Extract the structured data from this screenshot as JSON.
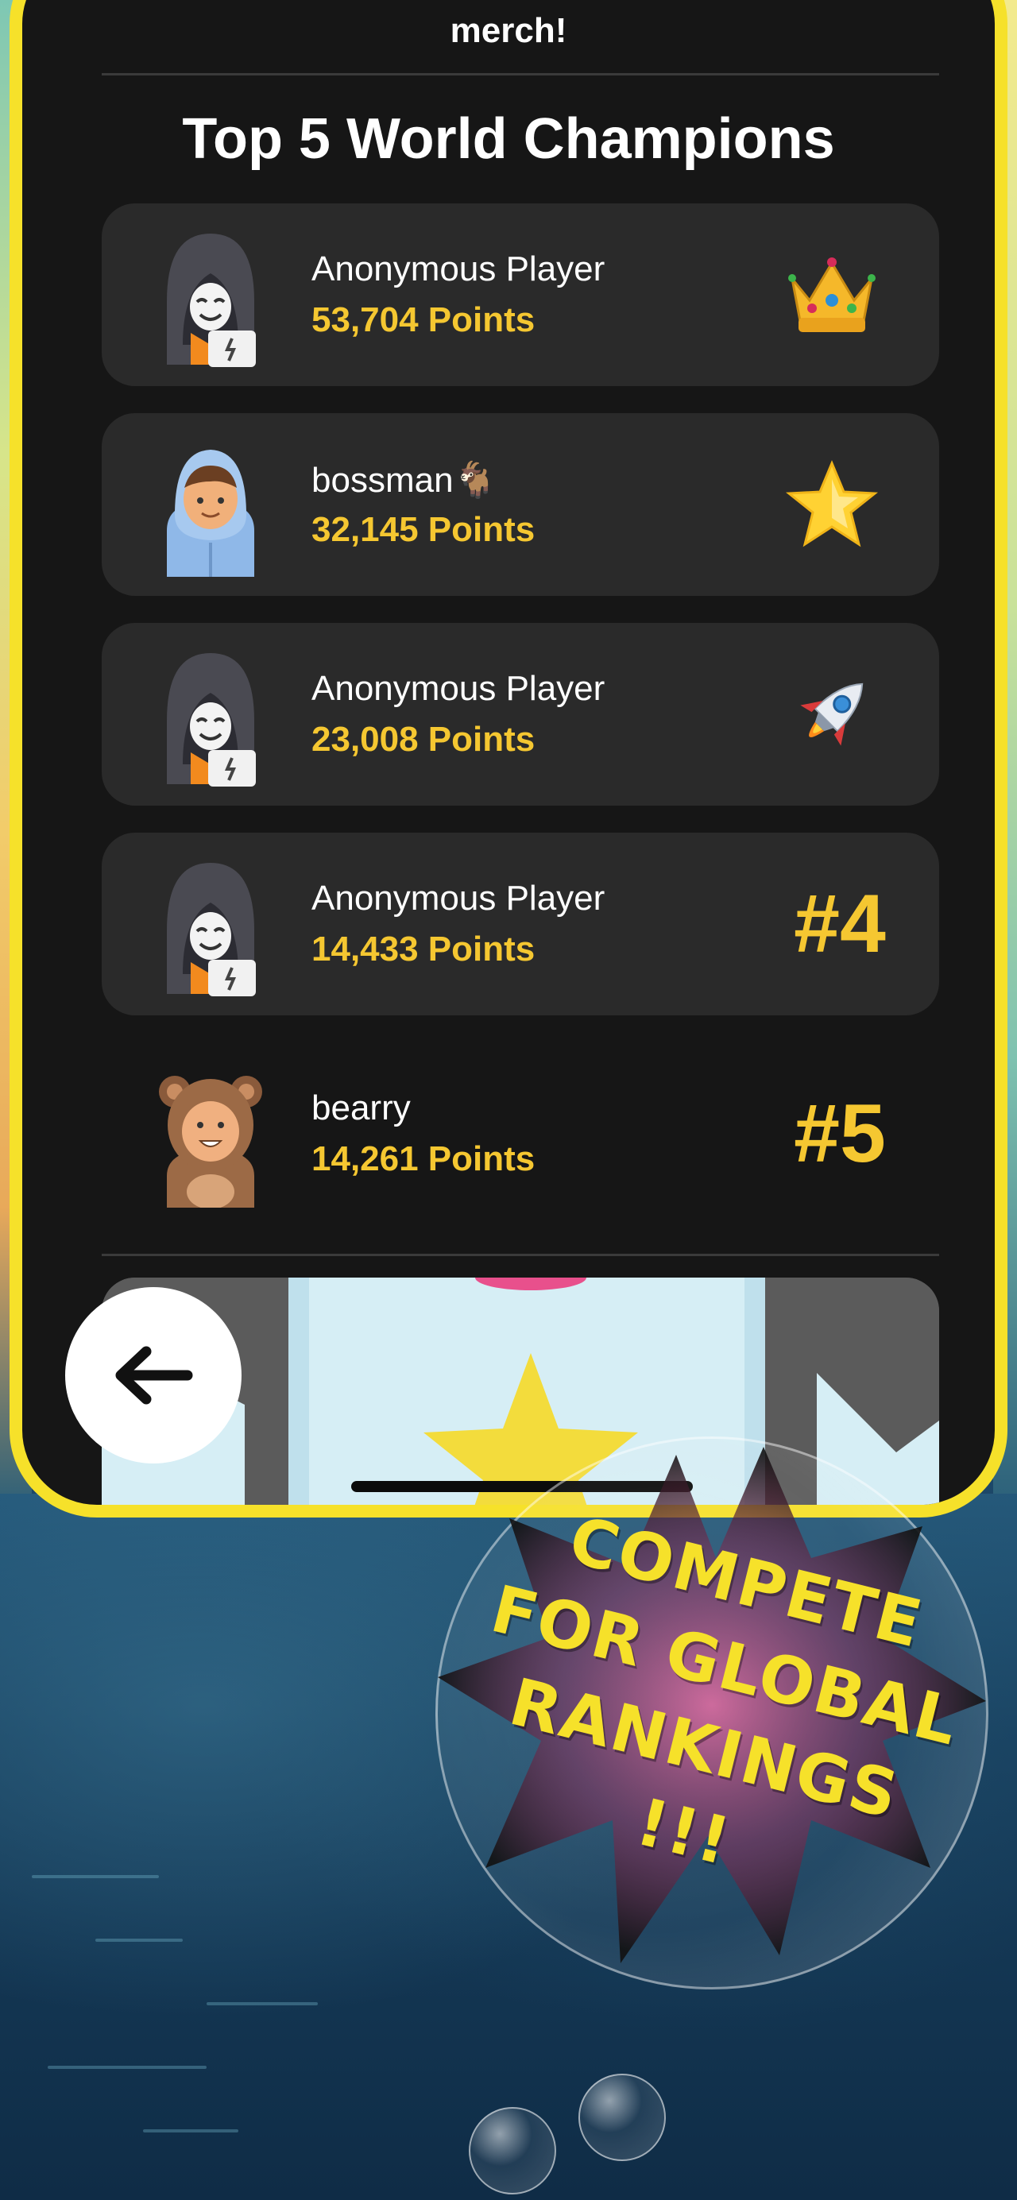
{
  "header": {
    "top_text": "merch!",
    "title": "Top 5 World Champions"
  },
  "leaderboard": [
    {
      "name": "Anonymous Player",
      "points": "53,704 Points",
      "avatar": "hacker-avatar-icon",
      "badge": "crown-icon"
    },
    {
      "name": "bossman🐐",
      "points": "32,145 Points",
      "avatar": "hoodie-boy-avatar-icon",
      "badge": "star-icon"
    },
    {
      "name": "Anonymous Player",
      "points": "23,008 Points",
      "avatar": "hacker-avatar-icon",
      "badge": "rocket-icon"
    },
    {
      "name": "Anonymous Player",
      "points": "14,433 Points",
      "avatar": "hacker-avatar-icon",
      "badge_text": "#4"
    },
    {
      "name": "bearry",
      "points": "14,261 Points",
      "avatar": "bear-avatar-icon",
      "badge_text": "#5"
    }
  ],
  "navigation": {
    "back_icon": "arrow-left-icon"
  },
  "promo": {
    "text": "COMPETE\nFOR GLOBAL\nRANKINGS\n!!!"
  },
  "colors": {
    "frame": "#f6e12a",
    "card": "#2a2a2a",
    "points": "#f5c731",
    "panel": "#161616"
  }
}
